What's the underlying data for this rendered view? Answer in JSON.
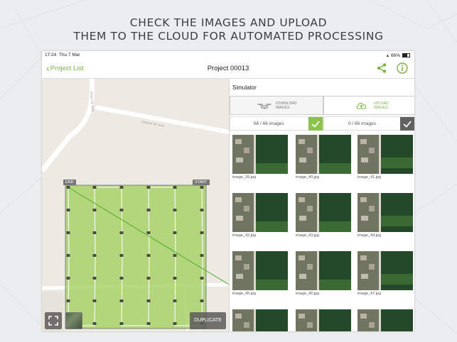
{
  "headline": {
    "line1": "CHECK THE IMAGES AND UPLOAD",
    "line2": "THEM TO THE CLOUD FOR AUTOMATED PROCESSING"
  },
  "status_bar": {
    "time": "17:24",
    "date": "Thu 7 Mar",
    "battery": "66%"
  },
  "nav": {
    "back_label": "Project List",
    "title": "Project 00013"
  },
  "map": {
    "road_label": "Chemin du Jura",
    "road_label_vertical": "Route du Jura",
    "end_label": "END",
    "start_label": "START",
    "duplicate_label": "DUPLICATE"
  },
  "panel": {
    "title": "Simulator",
    "download": {
      "line1": "DOWNLOAD",
      "line2": "IMAGES",
      "count": "66 / 66 images"
    },
    "upload": {
      "line1": "UPLOAD",
      "line2": "IMAGES",
      "count": "0 / 66 images"
    }
  },
  "images": [
    "image_39.jpg",
    "image_40.jpg",
    "image_41.jpg",
    "image_42.jpg",
    "image_43.jpg",
    "image_44.jpg",
    "image_45.jpg",
    "image_46.jpg",
    "image_47.jpg",
    "",
    "",
    ""
  ],
  "colors": {
    "accent": "#7cb342",
    "field_fill": "#a8d26a",
    "flight_line": "#4caf2b"
  }
}
